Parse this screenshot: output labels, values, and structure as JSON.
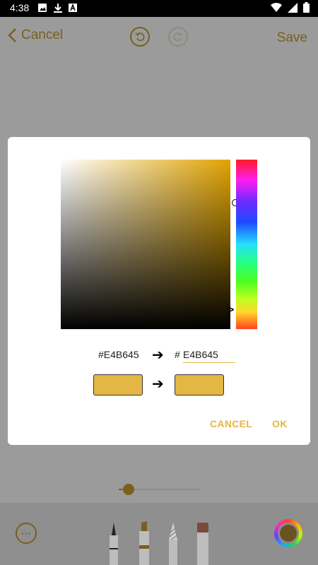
{
  "status_bar": {
    "time": "4:38",
    "icons": [
      "image-icon",
      "download-icon",
      "a-icon"
    ],
    "right_icons": [
      "wifi-icon",
      "signal-icon",
      "battery-icon"
    ]
  },
  "toolbar": {
    "cancel_label": "Cancel",
    "save_label": "Save"
  },
  "color_picker": {
    "selected_color": "#E4B645",
    "old_hex": "#E4B645",
    "arrow": "➔",
    "hash": "#",
    "new_hex_value": "E4B645",
    "cancel_label": "CANCEL",
    "ok_label": "OK",
    "accent_color": "#e4b645"
  },
  "bottom": {
    "more_label": "···",
    "stroke_size_fraction": 0.12
  }
}
